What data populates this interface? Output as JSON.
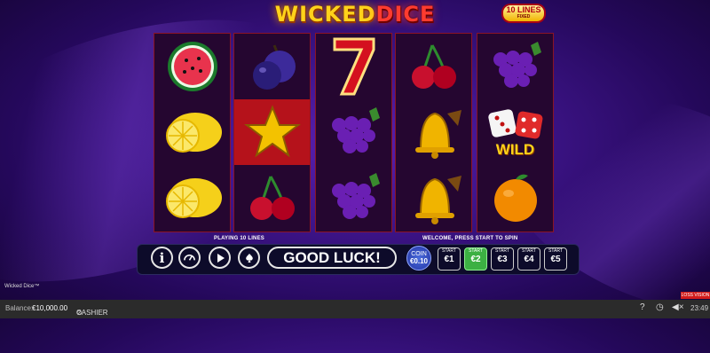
{
  "title": {
    "part1": "WICKED",
    "part2": "DICE"
  },
  "lines_badge": {
    "count": "10 LINES",
    "sub": "FIXED"
  },
  "reels": [
    [
      "watermelon",
      "lemon",
      "lemon"
    ],
    [
      "plum",
      "star",
      "cherry"
    ],
    [
      "seven",
      "grapes",
      "grapes"
    ],
    [
      "cherry",
      "bell",
      "bell"
    ],
    [
      "grapes",
      "wild-dice",
      "orange"
    ]
  ],
  "wild_label": "WILD",
  "messages": {
    "left": "PLAYING 10 LINES",
    "right": "WELCOME, PRESS START TO SPIN"
  },
  "controls": {
    "info": "i",
    "good_luck": "GOOD LUCK!",
    "coin_label": "COIN",
    "coin_value": "€0.10",
    "stakes": [
      {
        "top": "START",
        "value": "€1"
      },
      {
        "top": "START",
        "value": "€2"
      },
      {
        "top": "START",
        "value": "€3"
      },
      {
        "top": "START",
        "value": "€4"
      },
      {
        "top": "START",
        "value": "€5"
      }
    ]
  },
  "game_name": "Wicked Dice™",
  "status": {
    "balance_label": "Balance:",
    "balance_value": "€10,000.00",
    "cashier": "CASHIER",
    "help": "?",
    "time": "23:49"
  },
  "red_button": "LOSS VISION"
}
